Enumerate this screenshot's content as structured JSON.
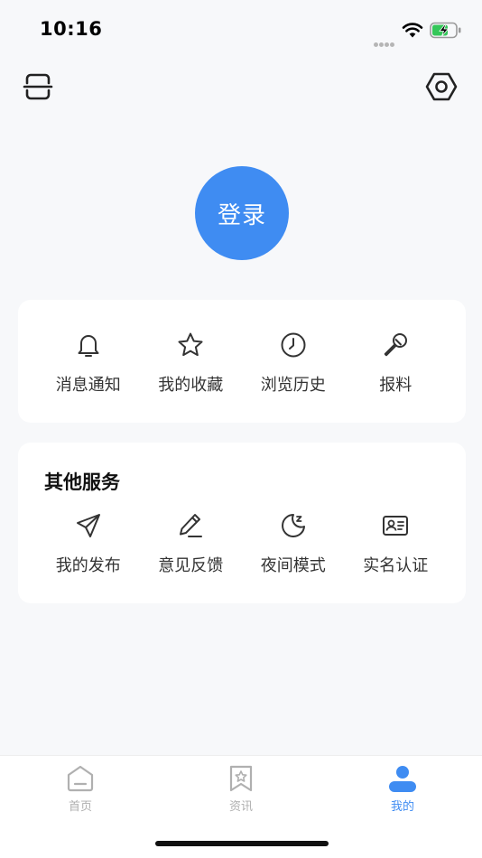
{
  "status_bar": {
    "time": "10:16"
  },
  "login": {
    "label": "登录"
  },
  "quick_actions": [
    {
      "label": "消息通知",
      "icon": "bell-icon"
    },
    {
      "label": "我的收藏",
      "icon": "star-icon"
    },
    {
      "label": "浏览历史",
      "icon": "clock-icon"
    },
    {
      "label": "报料",
      "icon": "microphone-icon"
    }
  ],
  "services": {
    "title": "其他服务",
    "items": [
      {
        "label": "我的发布",
        "icon": "paper-plane-icon"
      },
      {
        "label": "意见反馈",
        "icon": "pencil-icon"
      },
      {
        "label": "夜间模式",
        "icon": "moon-icon"
      },
      {
        "label": "实名认证",
        "icon": "id-card-icon"
      }
    ]
  },
  "tab_bar": {
    "tabs": [
      {
        "label": "首页",
        "icon": "home-icon",
        "active": false
      },
      {
        "label": "资讯",
        "icon": "bookmark-star-icon",
        "active": false
      },
      {
        "label": "我的",
        "icon": "person-icon",
        "active": true
      }
    ]
  },
  "colors": {
    "accent": "#3f8cf2",
    "background": "#f7f8fa",
    "card": "#ffffff",
    "inactive_tab": "#b0b0b0",
    "battery": "#34c759"
  }
}
